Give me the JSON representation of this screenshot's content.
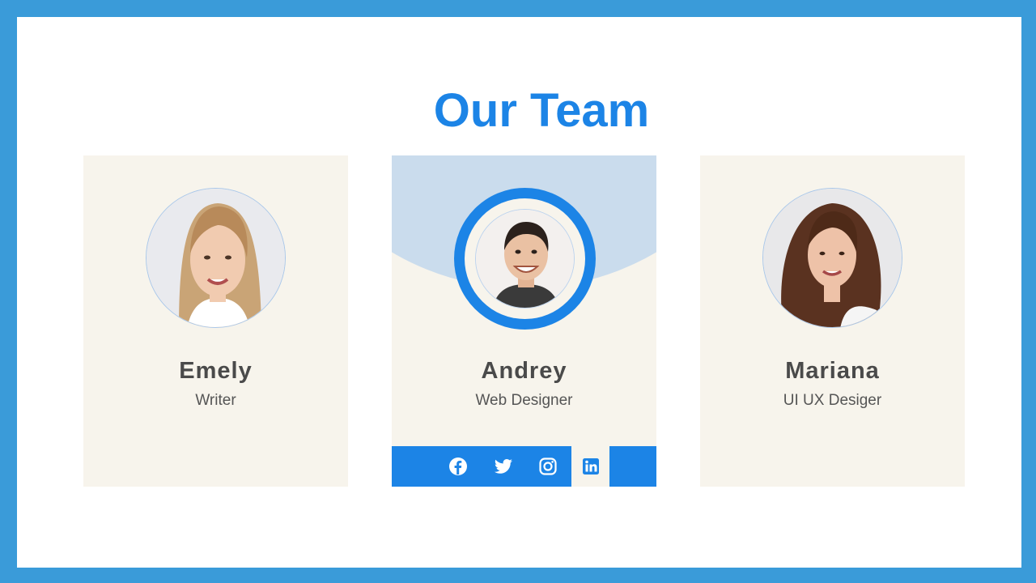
{
  "page": {
    "title": "Our Team",
    "colors": {
      "frame": "#3a9bd9",
      "accent": "#1c84e6",
      "card_bg": "#f7f4ec",
      "arc": "#cadced",
      "name_text": "#4a4a4a"
    }
  },
  "team": [
    {
      "name": "Emely",
      "role": "Writer",
      "photo": "woman-blonde-portrait"
    },
    {
      "name": "Andrey",
      "role": "Web Designer",
      "photo": "man-dark-hair-portrait",
      "social": [
        {
          "icon": "facebook-icon"
        },
        {
          "icon": "twitter-icon"
        },
        {
          "icon": "instagram-icon"
        },
        {
          "icon": "linkedin-icon"
        }
      ]
    },
    {
      "name": "Mariana",
      "role": "UI UX Desiger",
      "photo": "woman-curly-hair-portrait"
    }
  ]
}
